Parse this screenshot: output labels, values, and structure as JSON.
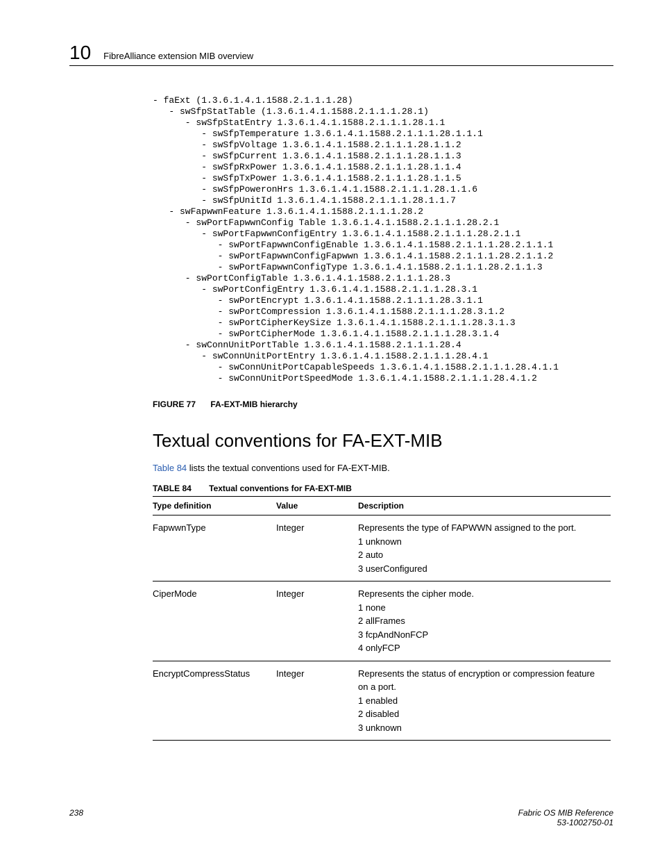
{
  "header": {
    "chapter_number": "10",
    "running_head": "FibreAlliance extension MIB overview"
  },
  "code_block": "- faExt (1.3.6.1.4.1.1588.2.1.1.1.28)\n   - swSfpStatTable (1.3.6.1.4.1.1588.2.1.1.1.28.1)\n      - swSfpStatEntry 1.3.6.1.4.1.1588.2.1.1.1.28.1.1\n         - swSfpTemperature 1.3.6.1.4.1.1588.2.1.1.1.28.1.1.1\n         - swSfpVoltage 1.3.6.1.4.1.1588.2.1.1.1.28.1.1.2\n         - swSfpCurrent 1.3.6.1.4.1.1588.2.1.1.1.28.1.1.3\n         - swSfpRxPower 1.3.6.1.4.1.1588.2.1.1.1.28.1.1.4\n         - swSfpTxPower 1.3.6.1.4.1.1588.2.1.1.1.28.1.1.5\n         - swSfpPoweronHrs 1.3.6.1.4.1.1588.2.1.1.1.28.1.1.6\n         - swSfpUnitId 1.3.6.1.4.1.1588.2.1.1.1.28.1.1.7\n   - swFapwwnFeature 1.3.6.1.4.1.1588.2.1.1.1.28.2\n      - swPortFapwwnConfig Table 1.3.6.1.4.1.1588.2.1.1.1.28.2.1\n         - swPortFapwwnConfigEntry 1.3.6.1.4.1.1588.2.1.1.1.28.2.1.1\n            - swPortFapwwnConfigEnable 1.3.6.1.4.1.1588.2.1.1.1.28.2.1.1.1\n            - swPortFapwwnConfigFapwwn 1.3.6.1.4.1.1588.2.1.1.1.28.2.1.1.2\n            - swPortFapwwnConfigType 1.3.6.1.4.1.1588.2.1.1.1.28.2.1.1.3\n      - swPortConfigTable 1.3.6.1.4.1.1588.2.1.1.1.28.3\n         - swPortConfigEntry 1.3.6.1.4.1.1588.2.1.1.1.28.3.1\n            - swPortEncrypt 1.3.6.1.4.1.1588.2.1.1.1.28.3.1.1\n            - swPortCompression 1.3.6.1.4.1.1588.2.1.1.1.28.3.1.2\n            - swPortCipherKeySize 1.3.6.1.4.1.1588.2.1.1.1.28.3.1.3\n            - swPortCipherMode 1.3.6.1.4.1.1588.2.1.1.1.28.3.1.4\n      - swConnUnitPortTable 1.3.6.1.4.1.1588.2.1.1.1.28.4\n         - swConnUnitPortEntry 1.3.6.1.4.1.1588.2.1.1.1.28.4.1\n            - swConnUnitPortCapableSpeeds 1.3.6.1.4.1.1588.2.1.1.1.28.4.1.1\n            - swConnUnitPortSpeedMode 1.3.6.1.4.1.1588.2.1.1.1.28.4.1.2",
  "figure": {
    "label": "FIGURE 77",
    "title": "FA-EXT-MIB hierarchy"
  },
  "section_heading": "Textual conventions for FA-EXT-MIB",
  "body_text": {
    "link": "Table 84",
    "rest": " lists the textual conventions used for FA-EXT-MIB."
  },
  "table": {
    "label": "TABLE 84",
    "title": "Textual conventions for FA-EXT-MIB",
    "headers": [
      "Type definition",
      "Value",
      "Description"
    ],
    "rows": [
      {
        "type": "FapwwnType",
        "value": "Integer",
        "description": "Represents the type of FAPWWN assigned to the port.\n1 unknown\n2 auto\n3 userConfigured"
      },
      {
        "type": "CiperMode",
        "value": "Integer",
        "description": "Represents the cipher mode.\n1 none\n2 allFrames\n3 fcpAndNonFCP\n4 onlyFCP"
      },
      {
        "type": "EncryptCompressStatus",
        "value": "Integer",
        "description": "Represents the status of encryption or compression feature on a port.\n1 enabled\n2 disabled\n3 unknown"
      }
    ]
  },
  "footer": {
    "page_number": "238",
    "doc_title": "Fabric OS MIB Reference",
    "doc_number": "53-1002750-01"
  }
}
